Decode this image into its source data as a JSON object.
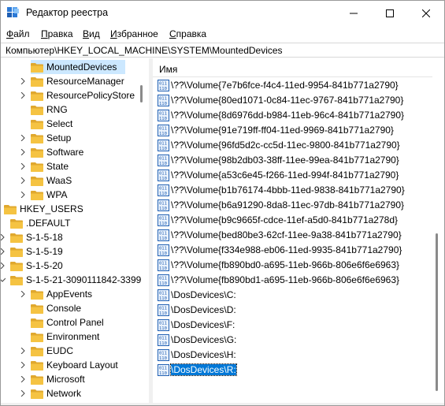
{
  "window": {
    "title": "Редактор реестра"
  },
  "menu": {
    "file": {
      "underlined": "Ф",
      "rest": "айл"
    },
    "edit": {
      "underlined": "П",
      "rest": "равка"
    },
    "view": {
      "underlined": "В",
      "rest": "ид"
    },
    "favorites": {
      "underlined": "И",
      "rest": "збранное"
    },
    "help": {
      "underlined": "С",
      "rest": "правка"
    }
  },
  "address": "Компьютер\\HKEY_LOCAL_MACHINE\\SYSTEM\\MountedDevices",
  "tree": {
    "items": [
      {
        "label": "MountedDevices",
        "selected": true
      },
      {
        "label": "ResourceManager"
      },
      {
        "label": "ResourcePolicyStore"
      },
      {
        "label": "RNG"
      },
      {
        "label": "Select"
      },
      {
        "label": "Setup"
      },
      {
        "label": "Software"
      },
      {
        "label": "State"
      },
      {
        "label": "WaaS"
      },
      {
        "label": "WPA"
      },
      {
        "label": "HKEY_USERS"
      },
      {
        "label": ".DEFAULT"
      },
      {
        "label": "S-1-5-18"
      },
      {
        "label": "S-1-5-19"
      },
      {
        "label": "S-1-5-20"
      },
      {
        "label": "S-1-5-21-3090111842-3399"
      },
      {
        "label": "AppEvents"
      },
      {
        "label": "Console"
      },
      {
        "label": "Control Panel"
      },
      {
        "label": "Environment"
      },
      {
        "label": "EUDC"
      },
      {
        "label": "Keyboard Layout"
      },
      {
        "label": "Microsoft"
      },
      {
        "label": "Network"
      }
    ]
  },
  "values": {
    "column_name": "Имя",
    "rows": [
      {
        "label": "\\??\\Volume{7e7b6fce-f4c4-11ed-9954-841b771a2790}"
      },
      {
        "label": "\\??\\Volume{80ed1071-0c84-11ec-9767-841b771a2790}"
      },
      {
        "label": "\\??\\Volume{8d6976dd-b984-11eb-96c4-841b771a2790}"
      },
      {
        "label": "\\??\\Volume{91e719ff-ff04-11ed-9969-841b771a2790}"
      },
      {
        "label": "\\??\\Volume{96fd5d2c-cc5d-11ec-9800-841b771a2790}"
      },
      {
        "label": "\\??\\Volume{98b2db03-38ff-11ee-99ea-841b771a2790}"
      },
      {
        "label": "\\??\\Volume{a53c6e45-f266-11ed-994f-841b771a2790}"
      },
      {
        "label": "\\??\\Volume{b1b76174-4bbb-11ed-9838-841b771a2790}"
      },
      {
        "label": "\\??\\Volume{b6a91290-8da8-11ec-97db-841b771a2790}"
      },
      {
        "label": "\\??\\Volume{b9c9665f-cdce-11ef-a5d0-841b771a278d}"
      },
      {
        "label": "\\??\\Volume{bed80be3-62cf-11ee-9a38-841b771a2790}"
      },
      {
        "label": "\\??\\Volume{f334e988-eb06-11ed-9935-841b771a2790}"
      },
      {
        "label": "\\??\\Volume{fb890bd0-a695-11eb-966b-806e6f6e6963}"
      },
      {
        "label": "\\??\\Volume{fb890bd1-a695-11eb-966b-806e6f6e6963}"
      },
      {
        "label": "\\DosDevices\\C:"
      },
      {
        "label": "\\DosDevices\\D:"
      },
      {
        "label": "\\DosDevices\\F:"
      },
      {
        "label": "\\DosDevices\\G:"
      },
      {
        "label": "\\DosDevices\\H:"
      },
      {
        "label": "\\DosDevices\\R:",
        "selected": true
      }
    ]
  },
  "colors": {
    "folder": "#f5c342",
    "folder_dark": "#e0a82e",
    "selection": "#cce8ff",
    "value_selection": "#0078d7",
    "reg_icon": "#1f5fb3"
  }
}
